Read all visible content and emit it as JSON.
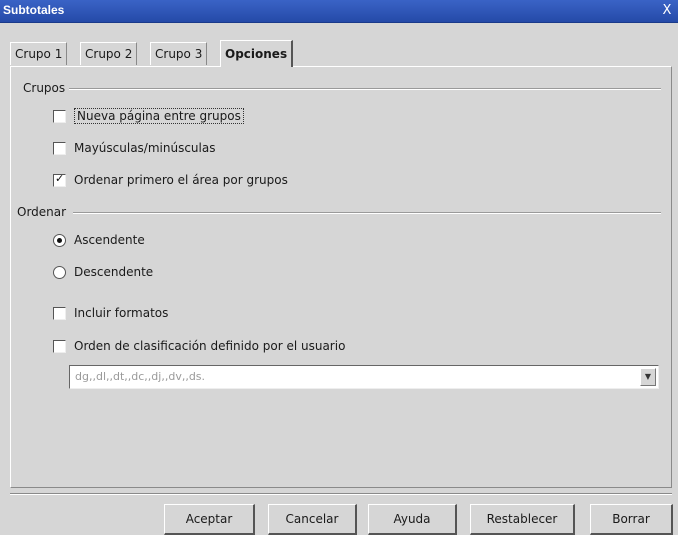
{
  "window": {
    "title": "Subtotales",
    "close_glyph": "X"
  },
  "tabs": [
    {
      "label": "Crupo 1"
    },
    {
      "label": "Crupo 2"
    },
    {
      "label": "Crupo 3"
    },
    {
      "label": "Opciones",
      "active": true
    }
  ],
  "groups": {
    "heading": "Crupos",
    "options": [
      {
        "label": "Nueva página entre grupos",
        "checked": false
      },
      {
        "label": "Mayúsculas/minúsculas",
        "checked": false
      },
      {
        "label": "Ordenar primero el área por grupos",
        "checked": true
      }
    ]
  },
  "sort": {
    "heading": "Ordenar",
    "radios": [
      {
        "label": "Ascendente",
        "selected": true
      },
      {
        "label": "Descendente",
        "selected": false
      }
    ],
    "options": [
      {
        "label": "Incluir formatos",
        "checked": false
      },
      {
        "label": "Orden de clasificación definido por el usuario",
        "checked": false
      }
    ],
    "custom_order_value": "dg,,dl,,dt,,dc,,dj,,dv,,ds."
  },
  "buttons": {
    "ok": "Aceptar",
    "cancel": "Cancelar",
    "help": "Ayuda",
    "reset": "Restablecer",
    "delete": "Borrar"
  }
}
